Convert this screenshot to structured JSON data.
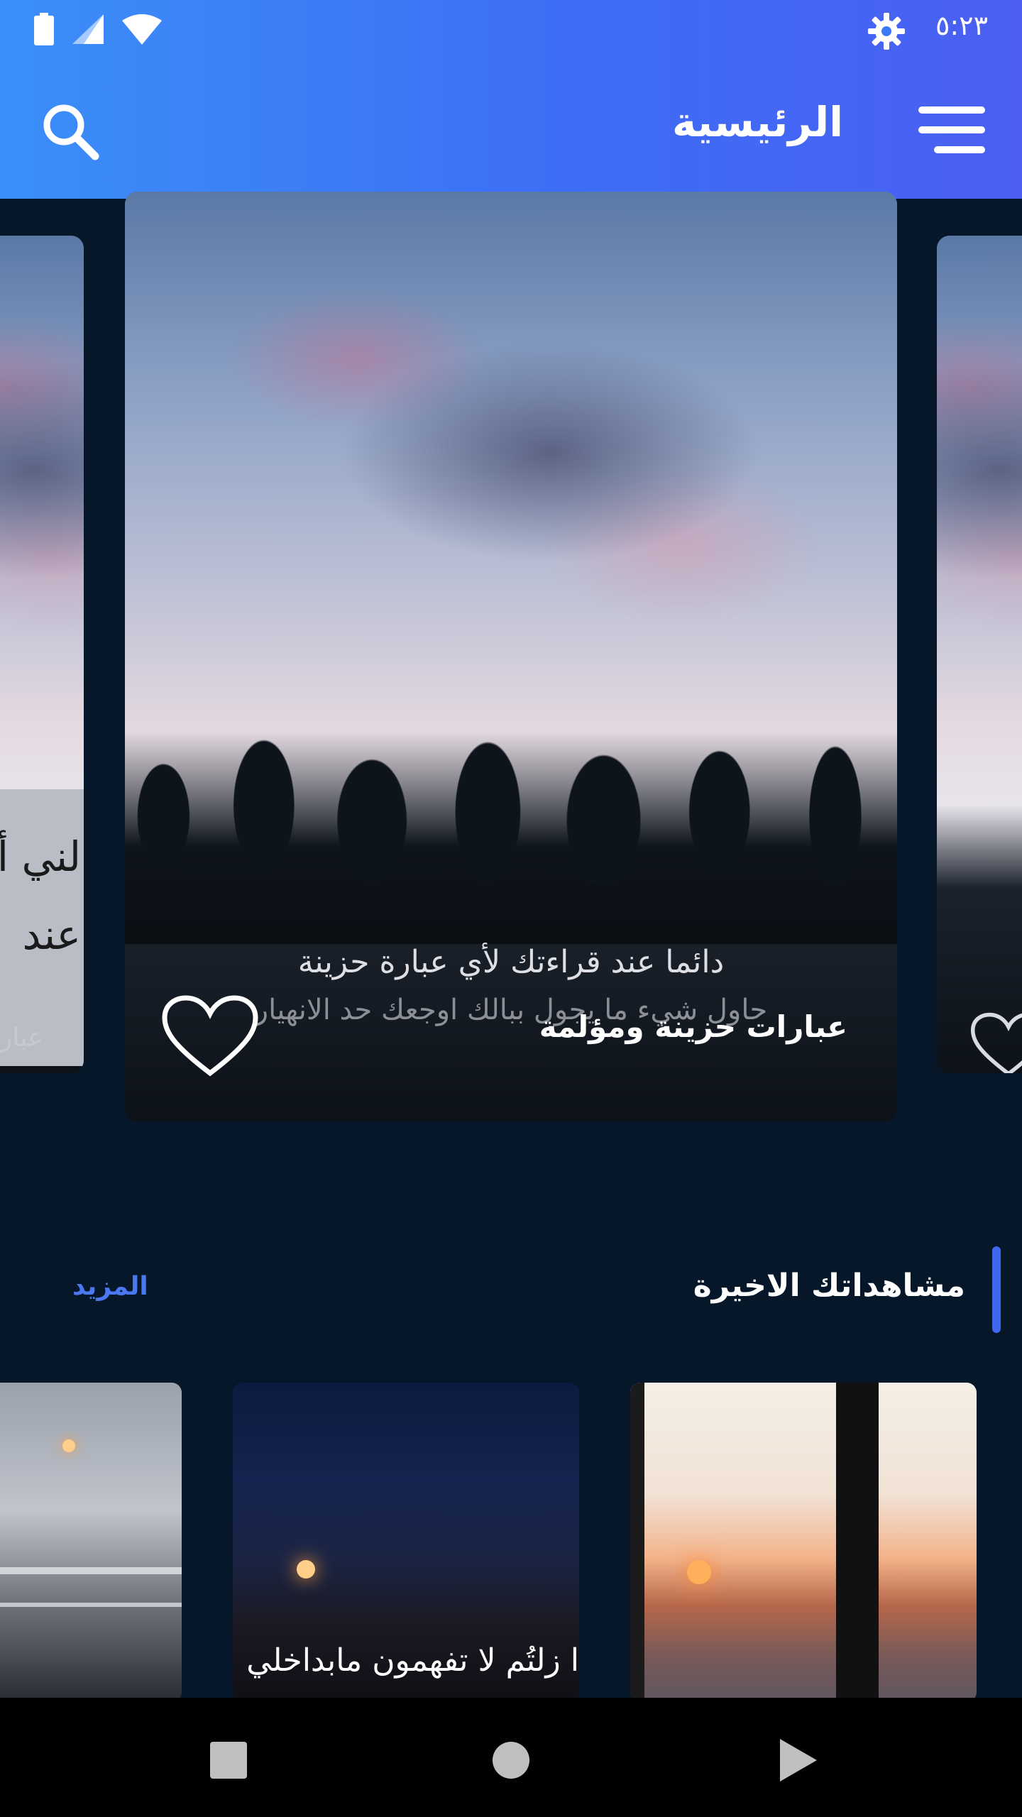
{
  "status_bar": {
    "time": "٥:٢٣"
  },
  "header": {
    "title": "الرئيسية",
    "menu_icon": "hamburger-icon",
    "search_icon": "search-icon",
    "settings_icon": "gear-icon"
  },
  "carousel": {
    "main_card": {
      "title": "عبارات حزينة ومؤلمة",
      "quote_line1": "دائما عند قراءتك لأي عبارة حزينة",
      "quote_line2": "حاول شيء ما يجول ببالك اوجعك حد الانهيار",
      "favorite_icon": "heart-outline-icon"
    },
    "left_card": {
      "overlay_text_line1": "لني أ",
      "overlay_text_line2": "عند",
      "label": "عبار"
    },
    "right_card": {
      "favorite_icon": "heart-outline-icon"
    }
  },
  "recent": {
    "title": "مشاهداتك الاخيرة",
    "more_label": "المزيد",
    "items": [
      {
        "caption": ""
      },
      {
        "caption": "ا زلتُم لا تفهمون مابداخلي"
      },
      {
        "caption": ""
      }
    ]
  },
  "colors": {
    "header_start": "#3b8ff8",
    "header_end": "#4b5ff2",
    "background": "#07172a",
    "accent": "#3f68ee"
  }
}
